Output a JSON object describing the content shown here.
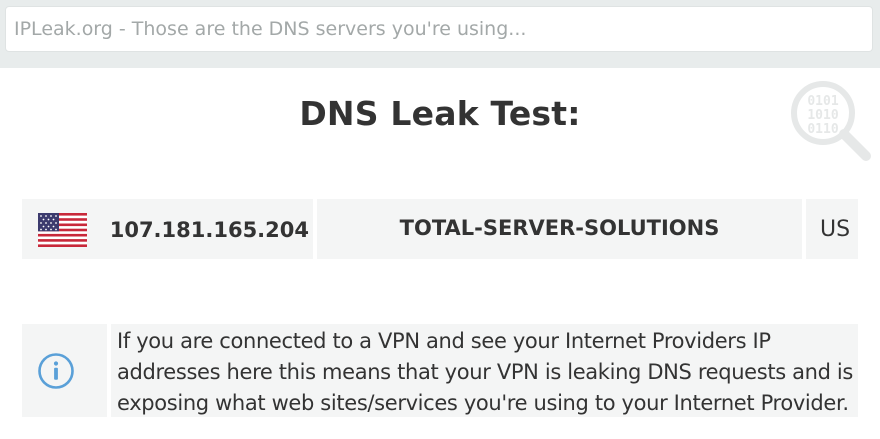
{
  "search": {
    "placeholder": "IPLeak.org - Those are the DNS servers you're using..."
  },
  "page": {
    "title": "DNS Leak Test:"
  },
  "icons": {
    "corner": "binary-search-icon",
    "flag": "us-flag-icon",
    "info": "info-icon"
  },
  "dns_servers": [
    {
      "flag": "US",
      "ip": "107.181.165.204",
      "isp": "TOTAL-SERVER-SOLUTIONS",
      "country_code": "US"
    }
  ],
  "notice": {
    "text": "If you are connected to a VPN and see your Internet Providers IP addresses here this means that your VPN is leaking DNS requests and is exposing what web sites/services you're using to your Internet Provider."
  },
  "colors": {
    "background": "#ffffff",
    "topbar": "#e8ecec",
    "cell": "#f4f5f5",
    "text": "#333333",
    "info_icon": "#5aa0d8",
    "corner_icon": "#e6e8e8"
  }
}
